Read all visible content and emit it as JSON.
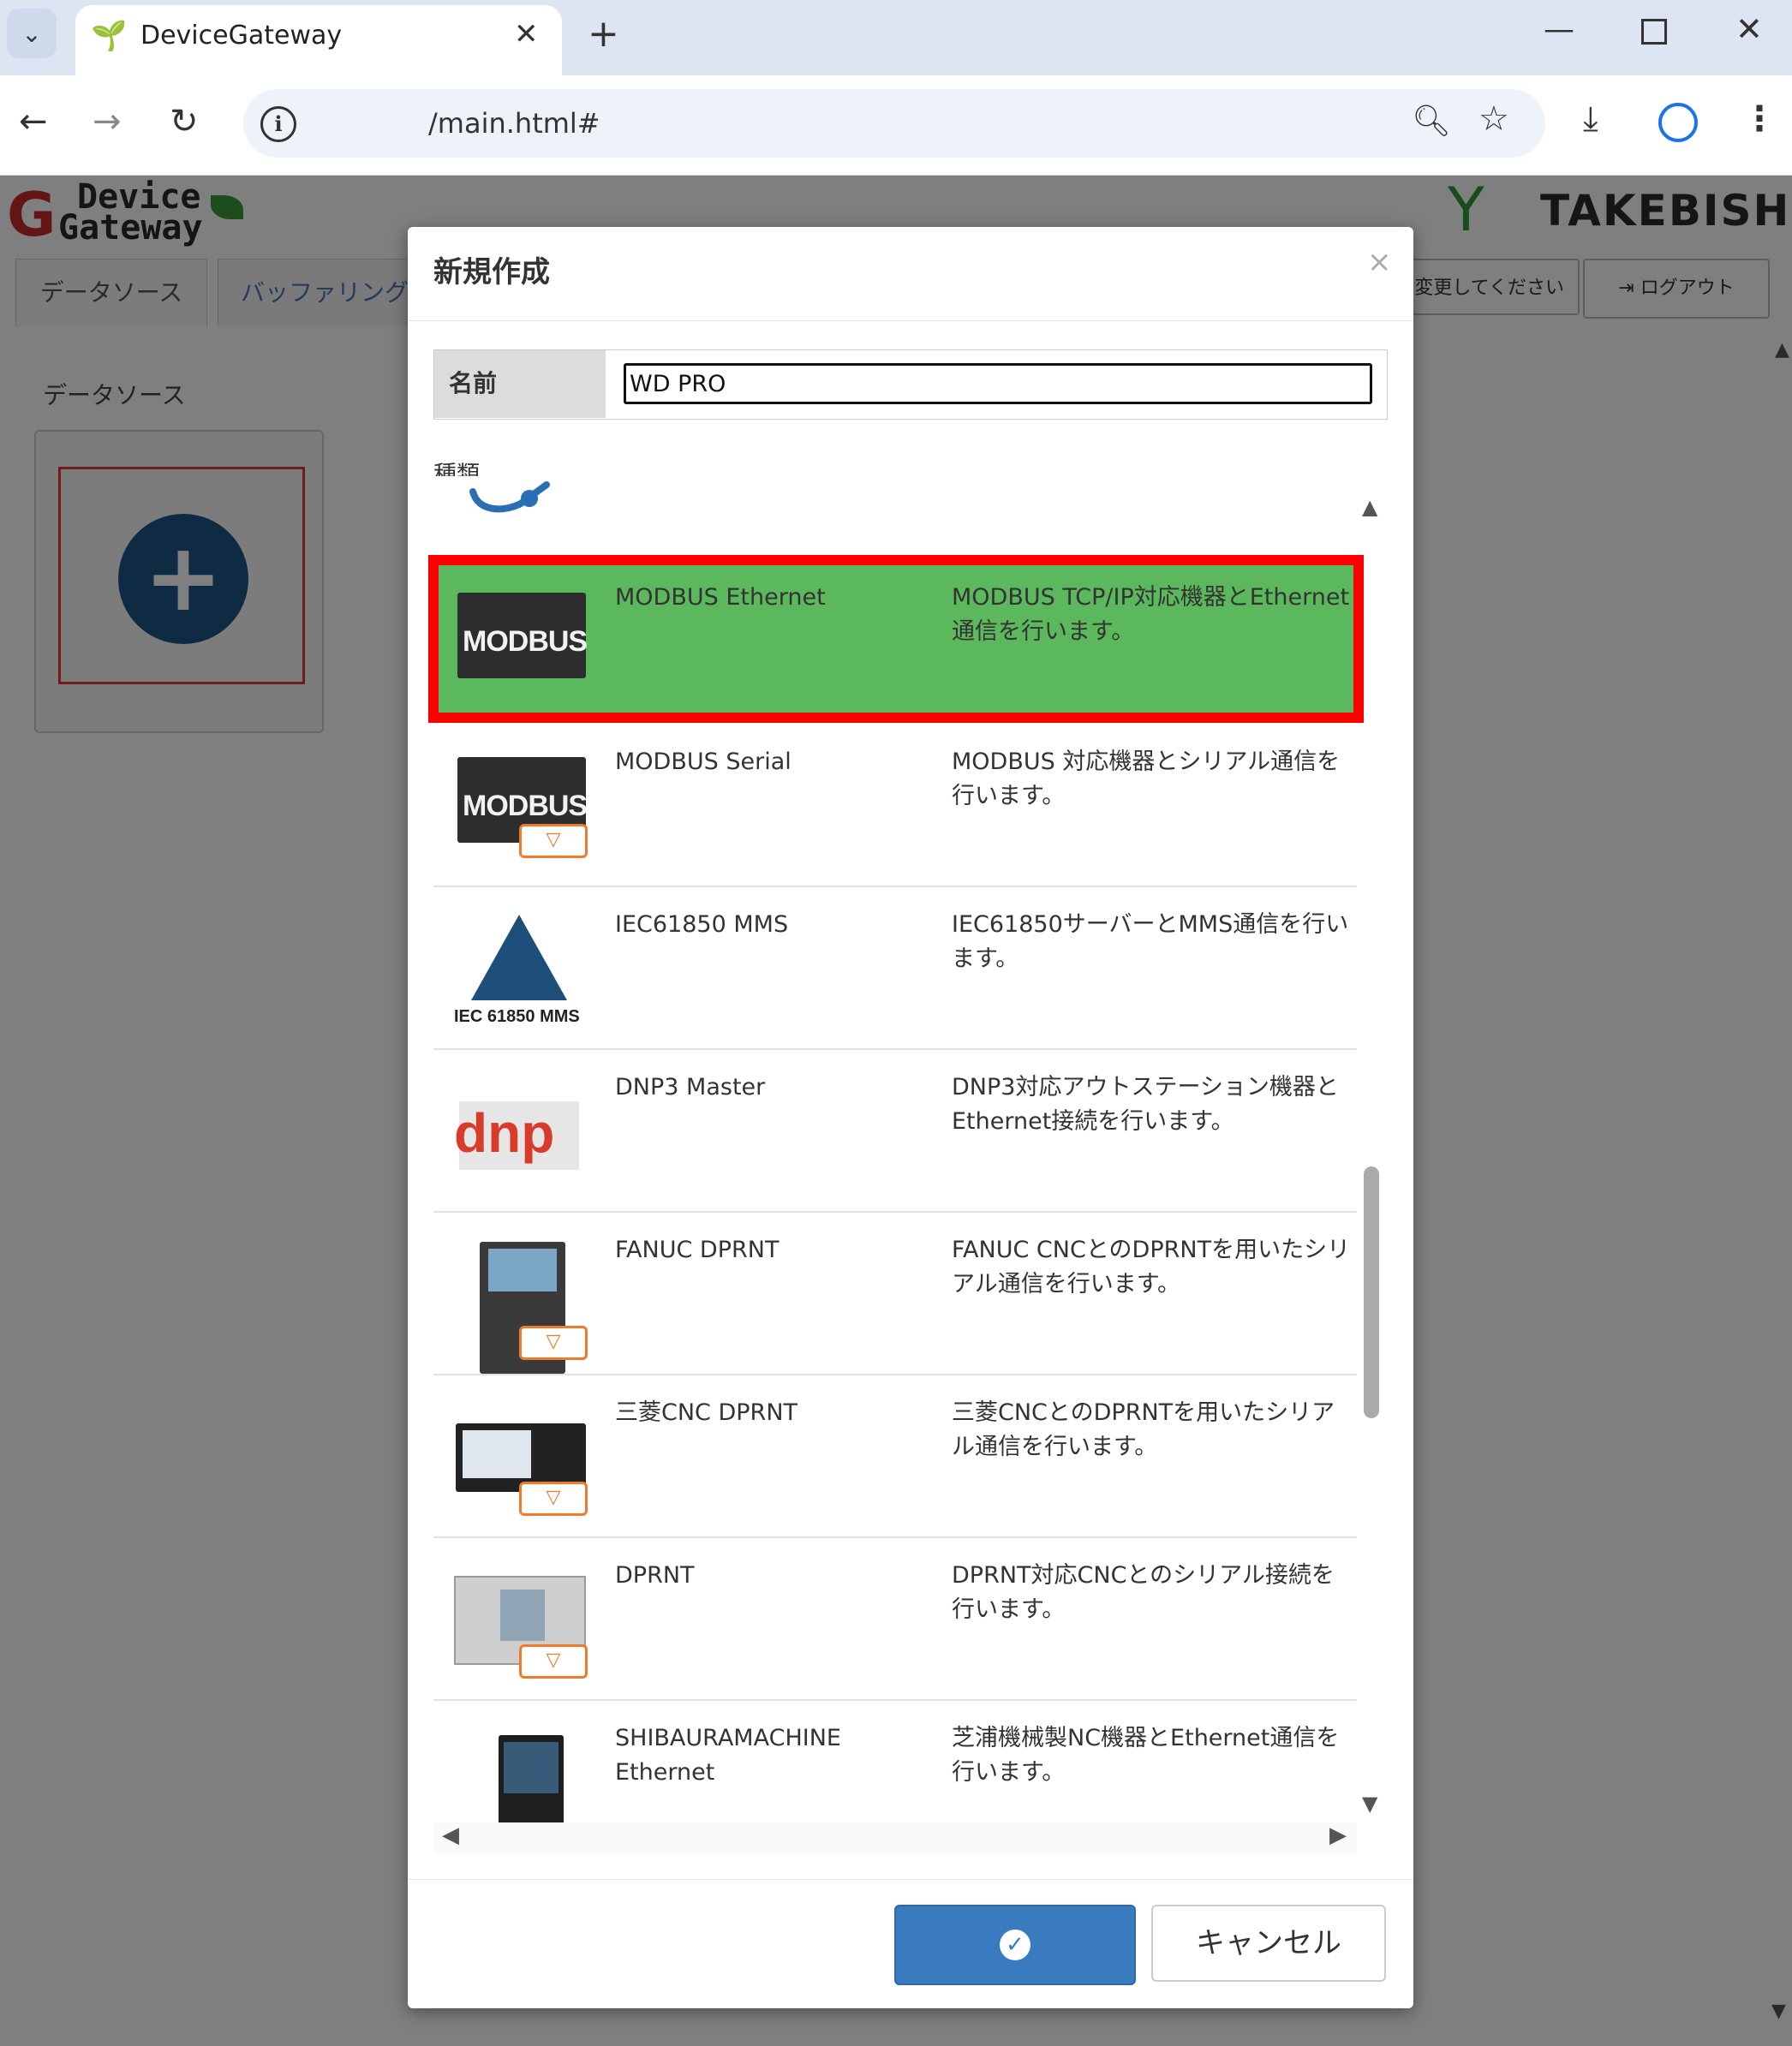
{
  "browser": {
    "tab_title": "DeviceGateway",
    "url": "/main.html#"
  },
  "app": {
    "logo_line1": "Device",
    "logo_line2": "Gateway",
    "brand": "TAKEBISHI",
    "tabs": [
      {
        "label": "データソース"
      },
      {
        "label": "バッファリング"
      }
    ],
    "header_buttons": {
      "change_label": "変更してください",
      "logout_label": "ログアウト"
    },
    "section_title": "データソース"
  },
  "modal": {
    "title": "新規作成",
    "close_label": "×",
    "name_label": "名前",
    "name_value": "WD PRO",
    "kind_label": "種類",
    "items": [
      {
        "name": "MODBUS Ethernet",
        "desc": "MODBUS TCP/IP対応機器とEthernet通信を行います。",
        "icon": "modbus-ethernet-icon",
        "selected": true
      },
      {
        "name": "MODBUS Serial",
        "desc": "MODBUS 対応機器とシリアル通信を行います。",
        "icon": "modbus-serial-icon",
        "selected": false
      },
      {
        "name": "IEC61850 MMS",
        "desc": "IEC61850サーバーとMMS通信を行います。",
        "icon": "iec61850-icon",
        "icon_caption": "IEC 61850 MMS",
        "selected": false
      },
      {
        "name": "DNP3 Master",
        "desc": "DNP3対応アウトステーション機器とEthernet接続を行います。",
        "icon": "dnp-icon",
        "icon_caption": "dnp",
        "selected": false
      },
      {
        "name": "FANUC DPRNT",
        "desc": "FANUC CNCとのDPRNTを用いたシリアル通信を行います。",
        "icon": "fanuc-cnc-icon",
        "selected": false
      },
      {
        "name": "三菱CNC DPRNT",
        "desc": "三菱CNCとのDPRNTを用いたシリアル通信を行います。",
        "icon": "mitsubishi-cnc-icon",
        "selected": false
      },
      {
        "name": "DPRNT",
        "desc": "DPRNT対応CNCとのシリアル接続を行います。",
        "icon": "cnc-machine-icon",
        "selected": false
      },
      {
        "name": "SHIBAURAMACHINE Ethernet",
        "desc": "芝浦機械製NC機器とEthernet通信を行います。",
        "icon": "shibaura-nc-icon",
        "selected": false
      }
    ],
    "cancel_label": "キャンセル"
  },
  "colors": {
    "selected_row": "#5cb85c",
    "highlight_border": "#ff0000",
    "primary_button": "#3a7bbf",
    "add_button": "#1f5789"
  }
}
